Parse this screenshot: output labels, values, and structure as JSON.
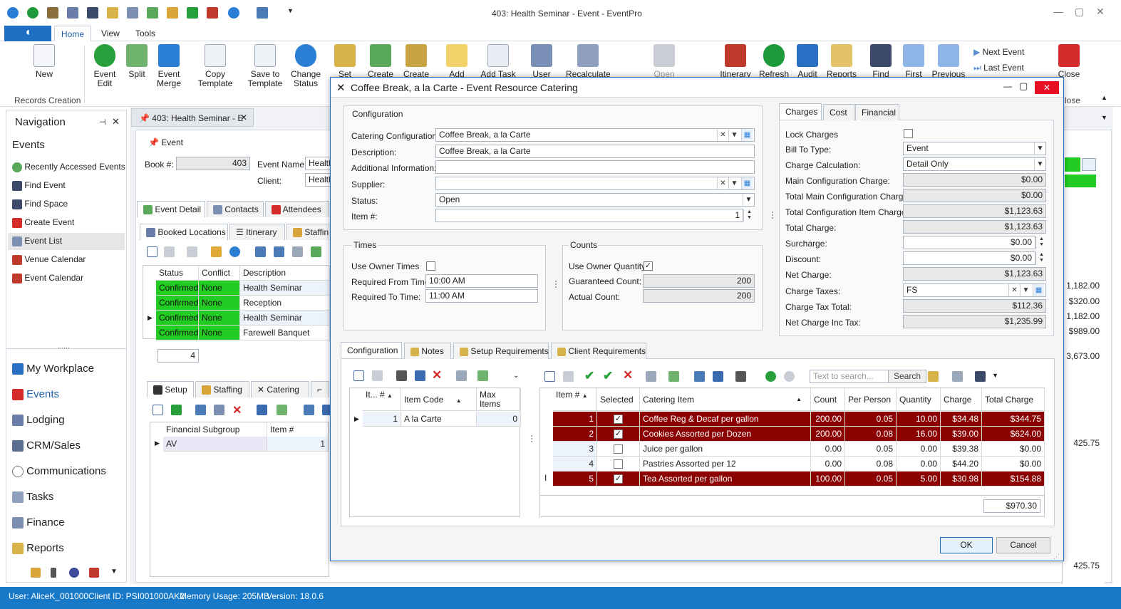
{
  "app": {
    "title": "403: Health Seminar - Event - EventPro"
  },
  "ribbon": {
    "tabs": [
      "Home",
      "View",
      "Tools"
    ],
    "group_label": "Records Creation",
    "buttons": {
      "new": "New",
      "event_edit": "Event Edit",
      "split": "Split",
      "event_merge": "Event Merge",
      "copy_template": "Copy Template",
      "save_template": "Save to Template",
      "change_status": "Change Status",
      "set_lock": "Set Lock",
      "create1": "Create",
      "create2": "Create",
      "add_note": "Add Note",
      "add_task": "Add Task",
      "user_fields": "User Fields",
      "recalculate": "Recalculate",
      "open_related": "Open Related",
      "itinerary": "Itinerary",
      "refresh": "Refresh",
      "audit": "Audit",
      "reports": "Reports",
      "find": "Find",
      "first": "First",
      "previous": "Previous",
      "next_event": "Next Event",
      "last_event": "Last Event",
      "close": "Close"
    },
    "close_group": "lose"
  },
  "navigation": {
    "title": "Navigation",
    "section": "Events",
    "items": [
      "Recently Accessed Events",
      "Find Event",
      "Find Space",
      "Create Event",
      "Event List",
      "Venue Calendar",
      "Event Calendar"
    ],
    "modules": [
      "My Workplace",
      "Events",
      "Lodging",
      "CRM/Sales",
      "Communications",
      "Tasks",
      "Finance",
      "Reports"
    ],
    "grip": "......"
  },
  "event": {
    "doc_tab": "403: Health Seminar - E",
    "section": "Event",
    "book_label": "Book #:",
    "book_value": "403",
    "name_label": "Event Name:",
    "name_value": "Health",
    "client_label": "Client:",
    "client_value": "Health",
    "tabs": [
      "Event Detail",
      "Contacts",
      "Attendees"
    ],
    "subtabs": [
      "Booked Locations",
      "Itinerary",
      "Staffin"
    ],
    "grid_cols": [
      "Status",
      "Conflict",
      "Description"
    ],
    "grid_rows": [
      {
        "status": "Confirmed",
        "conflict": "None",
        "desc": "Health Seminar"
      },
      {
        "status": "Confirmed",
        "conflict": "None",
        "desc": "Reception"
      },
      {
        "status": "Confirmed",
        "conflict": "None",
        "desc": "Health Seminar"
      },
      {
        "status": "Confirmed",
        "conflict": "None",
        "desc": "Farewell Banquet"
      }
    ],
    "count": "4",
    "lower_tabs": [
      "Setup",
      "Staffing",
      "Catering"
    ],
    "lower_cols": [
      "Financial Subgroup",
      "Item #"
    ],
    "lower_row": {
      "subgroup": "AV",
      "item": "1"
    },
    "right_values": [
      "1,182.00",
      "$320.00",
      "1,182.00",
      "$989.00",
      "3,673.00",
      "425.75",
      "425.75"
    ]
  },
  "dialog": {
    "title": "Coffee Break, a la Carte - Event Resource Catering",
    "config": {
      "group": "Configuration",
      "catering_label": "Catering Configuration:",
      "catering_value": "Coffee Break, a la Carte",
      "desc_label": "Description:",
      "desc_value": "Coffee Break, a la Carte",
      "addinfo_label": "Additional Information:",
      "addinfo_value": "",
      "supplier_label": "Supplier:",
      "supplier_value": "",
      "status_label": "Status:",
      "status_value": "Open",
      "item_label": "Item #:",
      "item_value": "1"
    },
    "times": {
      "group": "Times",
      "owner_label": "Use Owner Times",
      "from_label": "Required From Time:",
      "from_value": "10:00 AM",
      "to_label": "Required To Time:",
      "to_value": "11:00 AM"
    },
    "counts": {
      "group": "Counts",
      "owner_label": "Use Owner Quantity",
      "guaranteed_label": "Guaranteed Count:",
      "guaranteed_value": "200",
      "actual_label": "Actual Count:",
      "actual_value": "200"
    },
    "charges": {
      "tabs": [
        "Charges",
        "Cost",
        "Financial"
      ],
      "lock_label": "Lock Charges",
      "bill_label": "Bill To Type:",
      "bill_value": "Event",
      "calc_label": "Charge Calculation:",
      "calc_value": "Detail Only",
      "main_label": "Main Configuration Charge:",
      "main_value": "$0.00",
      "total_main_label": "Total Main Configuration Charge:",
      "total_main_value": "$0.00",
      "total_item_label": "Total Configuration Item Charge:",
      "total_item_value": "$1,123.63",
      "total_label": "Total Charge:",
      "total_value": "$1,123.63",
      "surcharge_label": "Surcharge:",
      "surcharge_value": "$0.00",
      "discount_label": "Discount:",
      "discount_value": "$0.00",
      "net_label": "Net Charge:",
      "net_value": "$1,123.63",
      "taxes_label": "Charge Taxes:",
      "taxes_value": "FS",
      "taxtotal_label": "Charge Tax Total:",
      "taxtotal_value": "$112.36",
      "netinc_label": "Net Charge Inc Tax:",
      "netinc_value": "$1,235.99"
    },
    "lower_tabs": [
      "Configuration",
      "Notes",
      "Setup Requirements",
      "Client Requirements"
    ],
    "items_grid": {
      "cols": [
        "It... #",
        "Item Code",
        "Max Items"
      ],
      "row": {
        "num": "1",
        "code": "A la Carte",
        "max": "0"
      }
    },
    "search_placeholder": "Text to search...",
    "search_button": "Search",
    "catering_grid": {
      "cols": [
        "Item #",
        "Selected",
        "Catering Item",
        "Count",
        "Per Person",
        "Quantity",
        "Charge",
        "Total Charge"
      ],
      "rows": [
        {
          "num": "1",
          "sel": true,
          "item": "Coffee Reg & Decaf per gallon",
          "count": "200.00",
          "pp": "0.05",
          "qty": "10.00",
          "charge": "$34.48",
          "total": "$344.75"
        },
        {
          "num": "2",
          "sel": true,
          "item": "Cookies Assorted per Dozen",
          "count": "200.00",
          "pp": "0.08",
          "qty": "16.00",
          "charge": "$39.00",
          "total": "$624.00"
        },
        {
          "num": "3",
          "sel": false,
          "item": "Juice per gallon",
          "count": "0.00",
          "pp": "0.05",
          "qty": "0.00",
          "charge": "$39.38",
          "total": "$0.00"
        },
        {
          "num": "4",
          "sel": false,
          "item": "Pastries Assorted per 12",
          "count": "0.00",
          "pp": "0.08",
          "qty": "0.00",
          "charge": "$44.20",
          "total": "$0.00"
        },
        {
          "num": "5",
          "sel": true,
          "item": "Tea Assorted per gallon",
          "count": "100.00",
          "pp": "0.05",
          "qty": "5.00",
          "charge": "$30.98",
          "total": "$154.88"
        }
      ],
      "sum": "$970.30"
    },
    "ok": "OK",
    "cancel": "Cancel"
  },
  "status_bar": {
    "user": "User: AliceK_001000",
    "client": "Client ID: PSI001000AK2",
    "memory": "Memory Usage: 205MB",
    "version": "Version: 18.0.6"
  },
  "colors": {
    "accent": "#1e6fc4",
    "selected_row": "#8b0000",
    "confirmed": "#22cc22",
    "statusbar": "#1979c9"
  }
}
